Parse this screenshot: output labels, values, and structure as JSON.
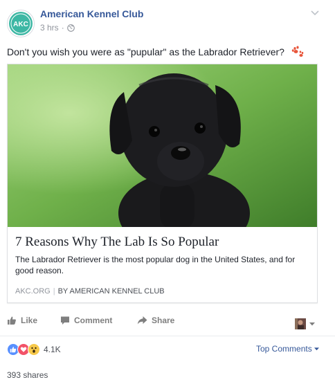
{
  "post": {
    "page_name": "American Kennel Club",
    "avatar_text": "AKC",
    "time": "3 hrs",
    "dot": "·",
    "privacy_icon": "globe-icon",
    "text": "Don't you wish you were as \"pupular\" as the Labrador Retriever?",
    "emoji_icon": "paw-prints-icon"
  },
  "link": {
    "title": "7 Reasons Why The Lab Is So Popular",
    "description": "The Labrador Retriever is the most popular dog in the United States, and for good reason.",
    "domain": "AKC.ORG",
    "separator": "|",
    "author": "BY AMERICAN KENNEL CLUB"
  },
  "actions": {
    "like": "Like",
    "comment": "Comment",
    "share": "Share"
  },
  "stats": {
    "reaction_count": "4.1K",
    "top_comments": "Top Comments",
    "shares": "393 shares"
  },
  "colors": {
    "brand_blue": "#365899",
    "akc_teal": "#3db7a4",
    "like_blue": "#5890ff",
    "love_red": "#f25268",
    "wow_yellow": "#f7c94b"
  }
}
